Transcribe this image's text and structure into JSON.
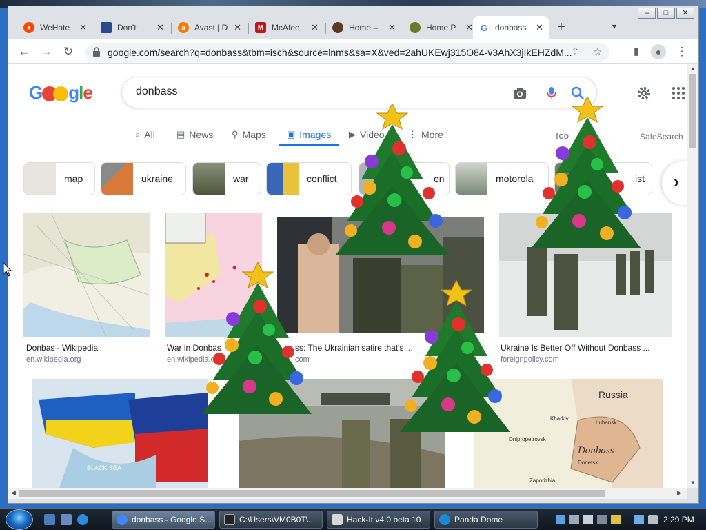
{
  "browser": {
    "tabs": [
      {
        "title": "WeHate",
        "favicon_color": "#ff4500"
      },
      {
        "title": "Don't",
        "favicon_color": "#2b4a8a"
      },
      {
        "title": "Avast | D",
        "favicon_color": "#ff7800"
      },
      {
        "title": "McAfee",
        "favicon_color": "#c01818"
      },
      {
        "title": "Home –",
        "favicon_color": "#5a3a22"
      },
      {
        "title": "Home P",
        "favicon_color": "#6a7a2a"
      },
      {
        "title": "donbass",
        "favicon_color": "#4285f4",
        "active": true
      }
    ],
    "new_tab": "+",
    "url": "google.com/search?q=donbass&tbm=isch&source=lnms&sa=X&ved=2ahUKEwj315O84-v3AhX3jIkEHZdM...",
    "window_controls": [
      "–",
      "□",
      "✕"
    ]
  },
  "google": {
    "query": "donbass",
    "nav": [
      {
        "label": "All",
        "icon": "search-icon"
      },
      {
        "label": "News",
        "icon": "news-icon"
      },
      {
        "label": "Maps",
        "icon": "pin-icon"
      },
      {
        "label": "Images",
        "icon": "image-icon",
        "active": true
      },
      {
        "label": "Video",
        "icon": "play-icon"
      },
      {
        "label": "More",
        "icon": "more-icon"
      }
    ],
    "tools": "Too",
    "safesearch": "SafeSearch",
    "chips": [
      {
        "label": "map",
        "color": "#e7e5de"
      },
      {
        "label": "ukraine",
        "color": "#d97a3a"
      },
      {
        "label": "war",
        "color": "#5d6a4a"
      },
      {
        "label": "conflict",
        "color": "#3a66b8"
      },
      {
        "label": "on",
        "color": "#b0b4b8"
      },
      {
        "label": "motorola",
        "color": "#8a9a8a"
      },
      {
        "label": "ist",
        "color": "#777c70"
      }
    ],
    "results_row1": [
      {
        "title": "Donbas - Wikipedia",
        "source": "en.wikipedia.org"
      },
      {
        "title": "War in Donbas",
        "source": "en.wikipedia.o"
      },
      {
        "title": "ss: The Ukrainian satire that's ...",
        "source": "com"
      },
      {
        "title": "Ukraine Is Better Off Without Donbass ...",
        "source": "foreignpolicy.com"
      }
    ],
    "result_map_labels": {
      "russia": "Russia",
      "donbass": "Donbass",
      "kharkiv": "Kharkiv",
      "luhansk": "Luhansk",
      "dnipro": "Dnipropetrovsk",
      "donetsk": "Donetsk",
      "zaporizhia": "Zaporizhia",
      "black_sea": "BLACK SEA"
    }
  },
  "taskbar": {
    "tasks": [
      {
        "label": "donbass - Google S...",
        "active": true
      },
      {
        "label": "C:\\Users\\VM0B0T\\..."
      },
      {
        "label": "Hack-It v4.0 beta 10"
      },
      {
        "label": "Panda Dome"
      }
    ],
    "clock": "2:29 PM"
  }
}
